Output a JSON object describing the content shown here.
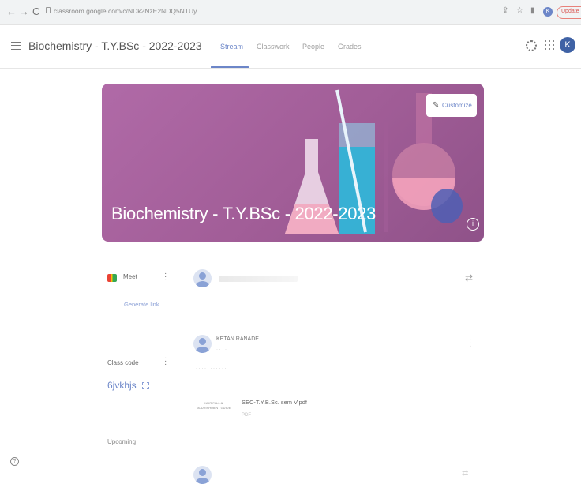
{
  "browser": {
    "url": "classroom.google.com/c/NDk2NzE2NDQ5NTUy",
    "avatar_initial": "K",
    "update_label": "Update"
  },
  "header": {
    "class_title": "Biochemistry - T.Y.BSc - 2022-2023",
    "tabs": [
      {
        "label": "Stream",
        "active": true
      },
      {
        "label": "Classwork",
        "active": false
      },
      {
        "label": "People",
        "active": false
      },
      {
        "label": "Grades",
        "active": false
      }
    ],
    "avatar_initial": "K",
    "accent_color": "#6c86c8"
  },
  "banner": {
    "title": "Biochemistry - T.Y.BSc - 2022-2023",
    "customize_label": "Customize",
    "info_glyph": "i",
    "theme_color": "#a15d97"
  },
  "sidebar": {
    "meet": {
      "label": "Meet",
      "link_label": "Generate link"
    },
    "class_code": {
      "label": "Class code",
      "value": "6jvkhjs"
    },
    "upcoming_label": "Upcoming"
  },
  "stream": {
    "post": {
      "author": "KETAN RANADE",
      "attachment": {
        "name": "SEC-T.Y.B.Sc. sem V.pdf",
        "type": "PDF",
        "thumb_text": "HAIR FALL & NOURISHMENT GUIDE"
      }
    }
  },
  "icons": [
    "back-icon",
    "forward-icon",
    "reload-icon",
    "lock-icon",
    "share-icon",
    "star-icon",
    "menu-icon",
    "settings-icon",
    "apps-icon",
    "pencil-icon",
    "info-icon",
    "meet-icon",
    "more-vert-icon",
    "expand-icon",
    "repost-icon",
    "help-icon"
  ]
}
